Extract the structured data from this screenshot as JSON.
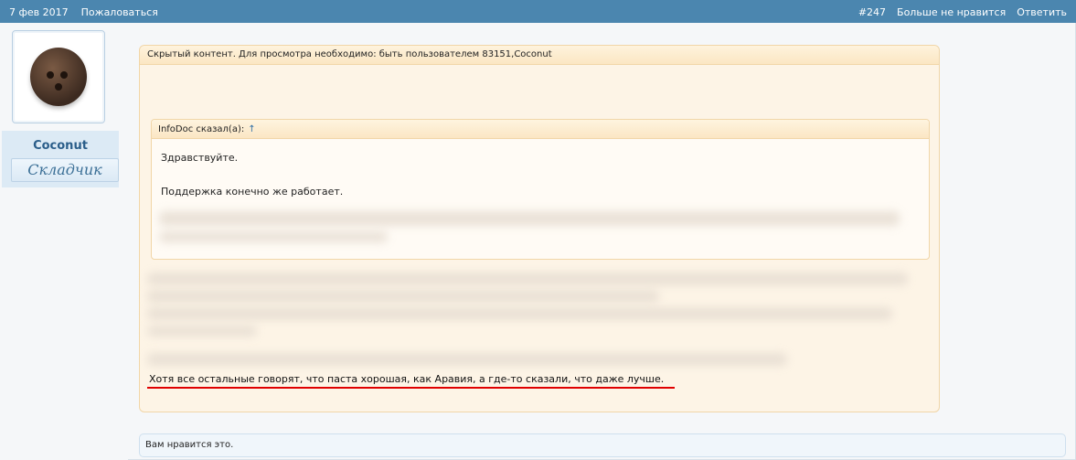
{
  "topbar": {
    "date": "7 фев 2017",
    "report": "Пожаловаться",
    "post_number": "#247",
    "unlike": "Больше не нравится",
    "reply": "Ответить"
  },
  "user": {
    "name": "Coconut",
    "title": "Складчик"
  },
  "post": {
    "hidden_notice": "Скрытый контент. Для просмотра необходимо: быть пользователем 83151,Coconut",
    "quote": {
      "author": "InfoDoc сказал(а):",
      "arrow": "↑",
      "line1": "Здравствуйте.",
      "line2": "Поддержка конечно же работает."
    },
    "final_line": "Хотя все остальные говорят, что паста хорошая, как Аравия, а где-то сказали, что даже лучше."
  },
  "likebar": {
    "text": "Вам нравится это."
  }
}
